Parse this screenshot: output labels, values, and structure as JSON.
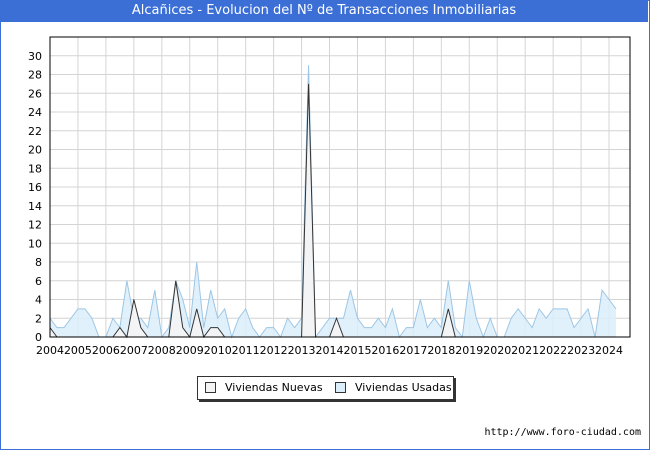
{
  "title": "Alcañices - Evolucion del Nº de Transacciones Inmobiliarias",
  "source": "http://www.foro-ciudad.com",
  "chart_data": {
    "type": "area",
    "title": "Alcañices - Evolucion del Nº de Transacciones Inmobiliarias",
    "xlabel": "",
    "ylabel": "",
    "x_range": [
      2004.0,
      2024.75
    ],
    "ylim": [
      0,
      32
    ],
    "y_ticks": [
      0,
      2,
      4,
      6,
      8,
      10,
      12,
      14,
      16,
      18,
      20,
      22,
      24,
      26,
      28,
      30
    ],
    "x_ticks": [
      2004,
      2005,
      2006,
      2007,
      2008,
      2009,
      2010,
      2011,
      2012,
      2013,
      2014,
      2015,
      2016,
      2017,
      2018,
      2019,
      2020,
      2021,
      2022,
      2023,
      2024
    ],
    "grid": true,
    "legend_position": "bottom",
    "quarters_per_year": 4,
    "series": [
      {
        "name": "Viviendas Nuevas",
        "color": "#f4f4f4",
        "line_color": "#333333",
        "values": [
          1,
          0,
          0,
          0,
          0,
          0,
          0,
          0,
          0,
          0,
          1,
          0,
          4,
          1,
          0,
          0,
          0,
          0,
          6,
          1,
          0,
          3,
          0,
          1,
          1,
          0,
          0,
          0,
          0,
          0,
          0,
          0,
          0,
          0,
          0,
          0,
          0,
          27,
          0,
          0,
          0,
          2,
          0,
          0,
          0,
          0,
          0,
          0,
          0,
          0,
          0,
          0,
          0,
          0,
          0,
          0,
          0,
          3,
          0,
          0,
          0,
          0,
          0,
          0,
          0,
          0,
          0,
          0,
          0,
          0,
          0,
          0,
          0,
          0,
          0,
          0,
          0,
          0,
          0,
          0,
          0,
          0,
          0,
          0
        ]
      },
      {
        "name": "Viviendas Usadas",
        "color": "#dceefa",
        "line_color": "#9cc6e6",
        "values": [
          2,
          1,
          1,
          2,
          3,
          3,
          2,
          0,
          0,
          2,
          1,
          6,
          2,
          2,
          1,
          5,
          0,
          1,
          6,
          4,
          1,
          8,
          1,
          5,
          2,
          3,
          0,
          2,
          3,
          1,
          0,
          1,
          1,
          0,
          2,
          1,
          2,
          29,
          0,
          1,
          2,
          2,
          2,
          5,
          2,
          1,
          1,
          2,
          1,
          3,
          0,
          1,
          1,
          4,
          1,
          2,
          1,
          6,
          1,
          0,
          6,
          2,
          0,
          2,
          0,
          0,
          2,
          3,
          2,
          1,
          3,
          2,
          3,
          3,
          3,
          1,
          2,
          3,
          0,
          5,
          4,
          3
        ]
      }
    ]
  }
}
